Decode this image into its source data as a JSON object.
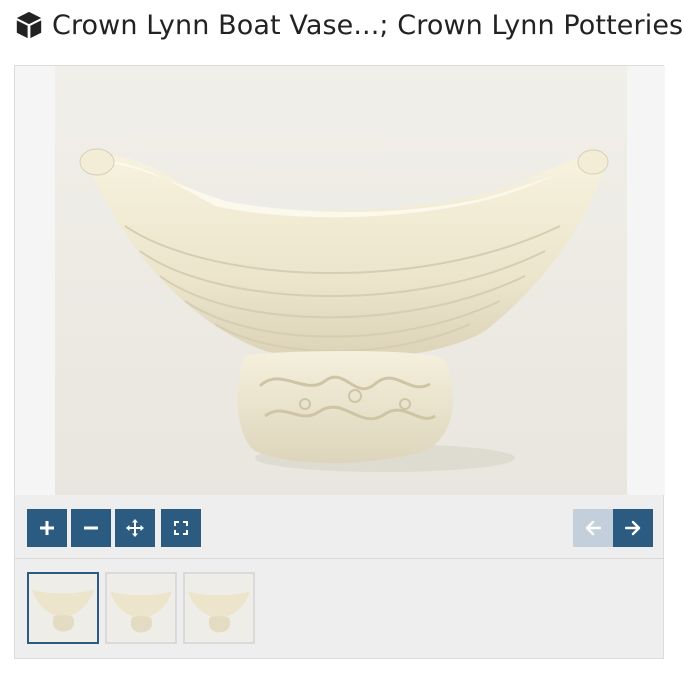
{
  "header": {
    "icon": "cube-icon",
    "title": "Crown Lynn Boat Vase...; Crown Lynn Potteries Limited"
  },
  "viewer": {
    "image_alt": "Cream ribbed boat-shaped vase on an ornate scrolled pedestal base",
    "controls": {
      "zoom_in_icon": "plus-icon",
      "zoom_out_icon": "minus-icon",
      "pan_icon": "move-icon",
      "fullscreen_icon": "fullscreen-icon",
      "prev_icon": "arrow-left-icon",
      "next_icon": "arrow-right-icon"
    },
    "thumbnails": [
      {
        "active": true
      },
      {
        "active": false
      },
      {
        "active": false
      }
    ]
  },
  "colors": {
    "accent": "#2b5b80",
    "disabled": "#c3d0dc",
    "panel": "#eeeeee"
  }
}
